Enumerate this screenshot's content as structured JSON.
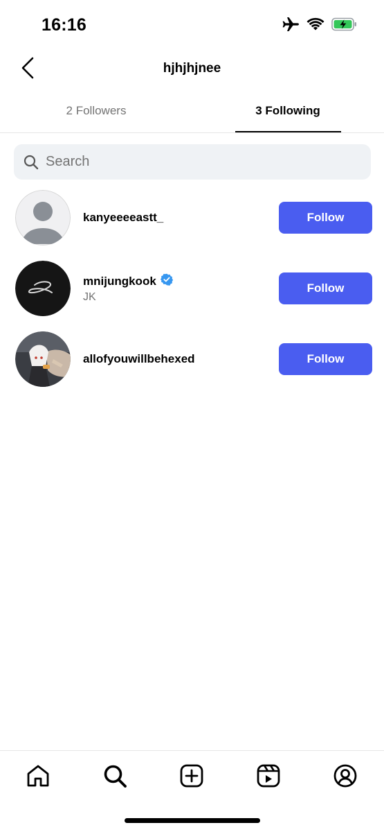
{
  "status_bar": {
    "time": "16:16"
  },
  "header": {
    "title": "hjhjhjnee"
  },
  "tabs": [
    {
      "label": "2 Followers",
      "active": false
    },
    {
      "label": "3 Following",
      "active": true
    }
  ],
  "search": {
    "placeholder": "Search",
    "value": ""
  },
  "users": [
    {
      "username": "kanyeeeeastt_",
      "subtitle": "",
      "verified": false,
      "button": "Follow",
      "avatar": "default-avatar"
    },
    {
      "username": "mnijungkook",
      "subtitle": "JK",
      "verified": true,
      "button": "Follow",
      "avatar": "signature-logo"
    },
    {
      "username": "allofyouwillbehexed",
      "subtitle": "",
      "verified": false,
      "button": "Follow",
      "avatar": "photo"
    }
  ],
  "bottom_nav": [
    {
      "icon": "home-icon"
    },
    {
      "icon": "search-icon"
    },
    {
      "icon": "create-icon"
    },
    {
      "icon": "reels-icon"
    },
    {
      "icon": "profile-icon"
    }
  ],
  "colors": {
    "follow_button": "#4a5df0",
    "verified": "#3797f0",
    "search_bg": "#eff2f5",
    "secondary_text": "#737373"
  }
}
